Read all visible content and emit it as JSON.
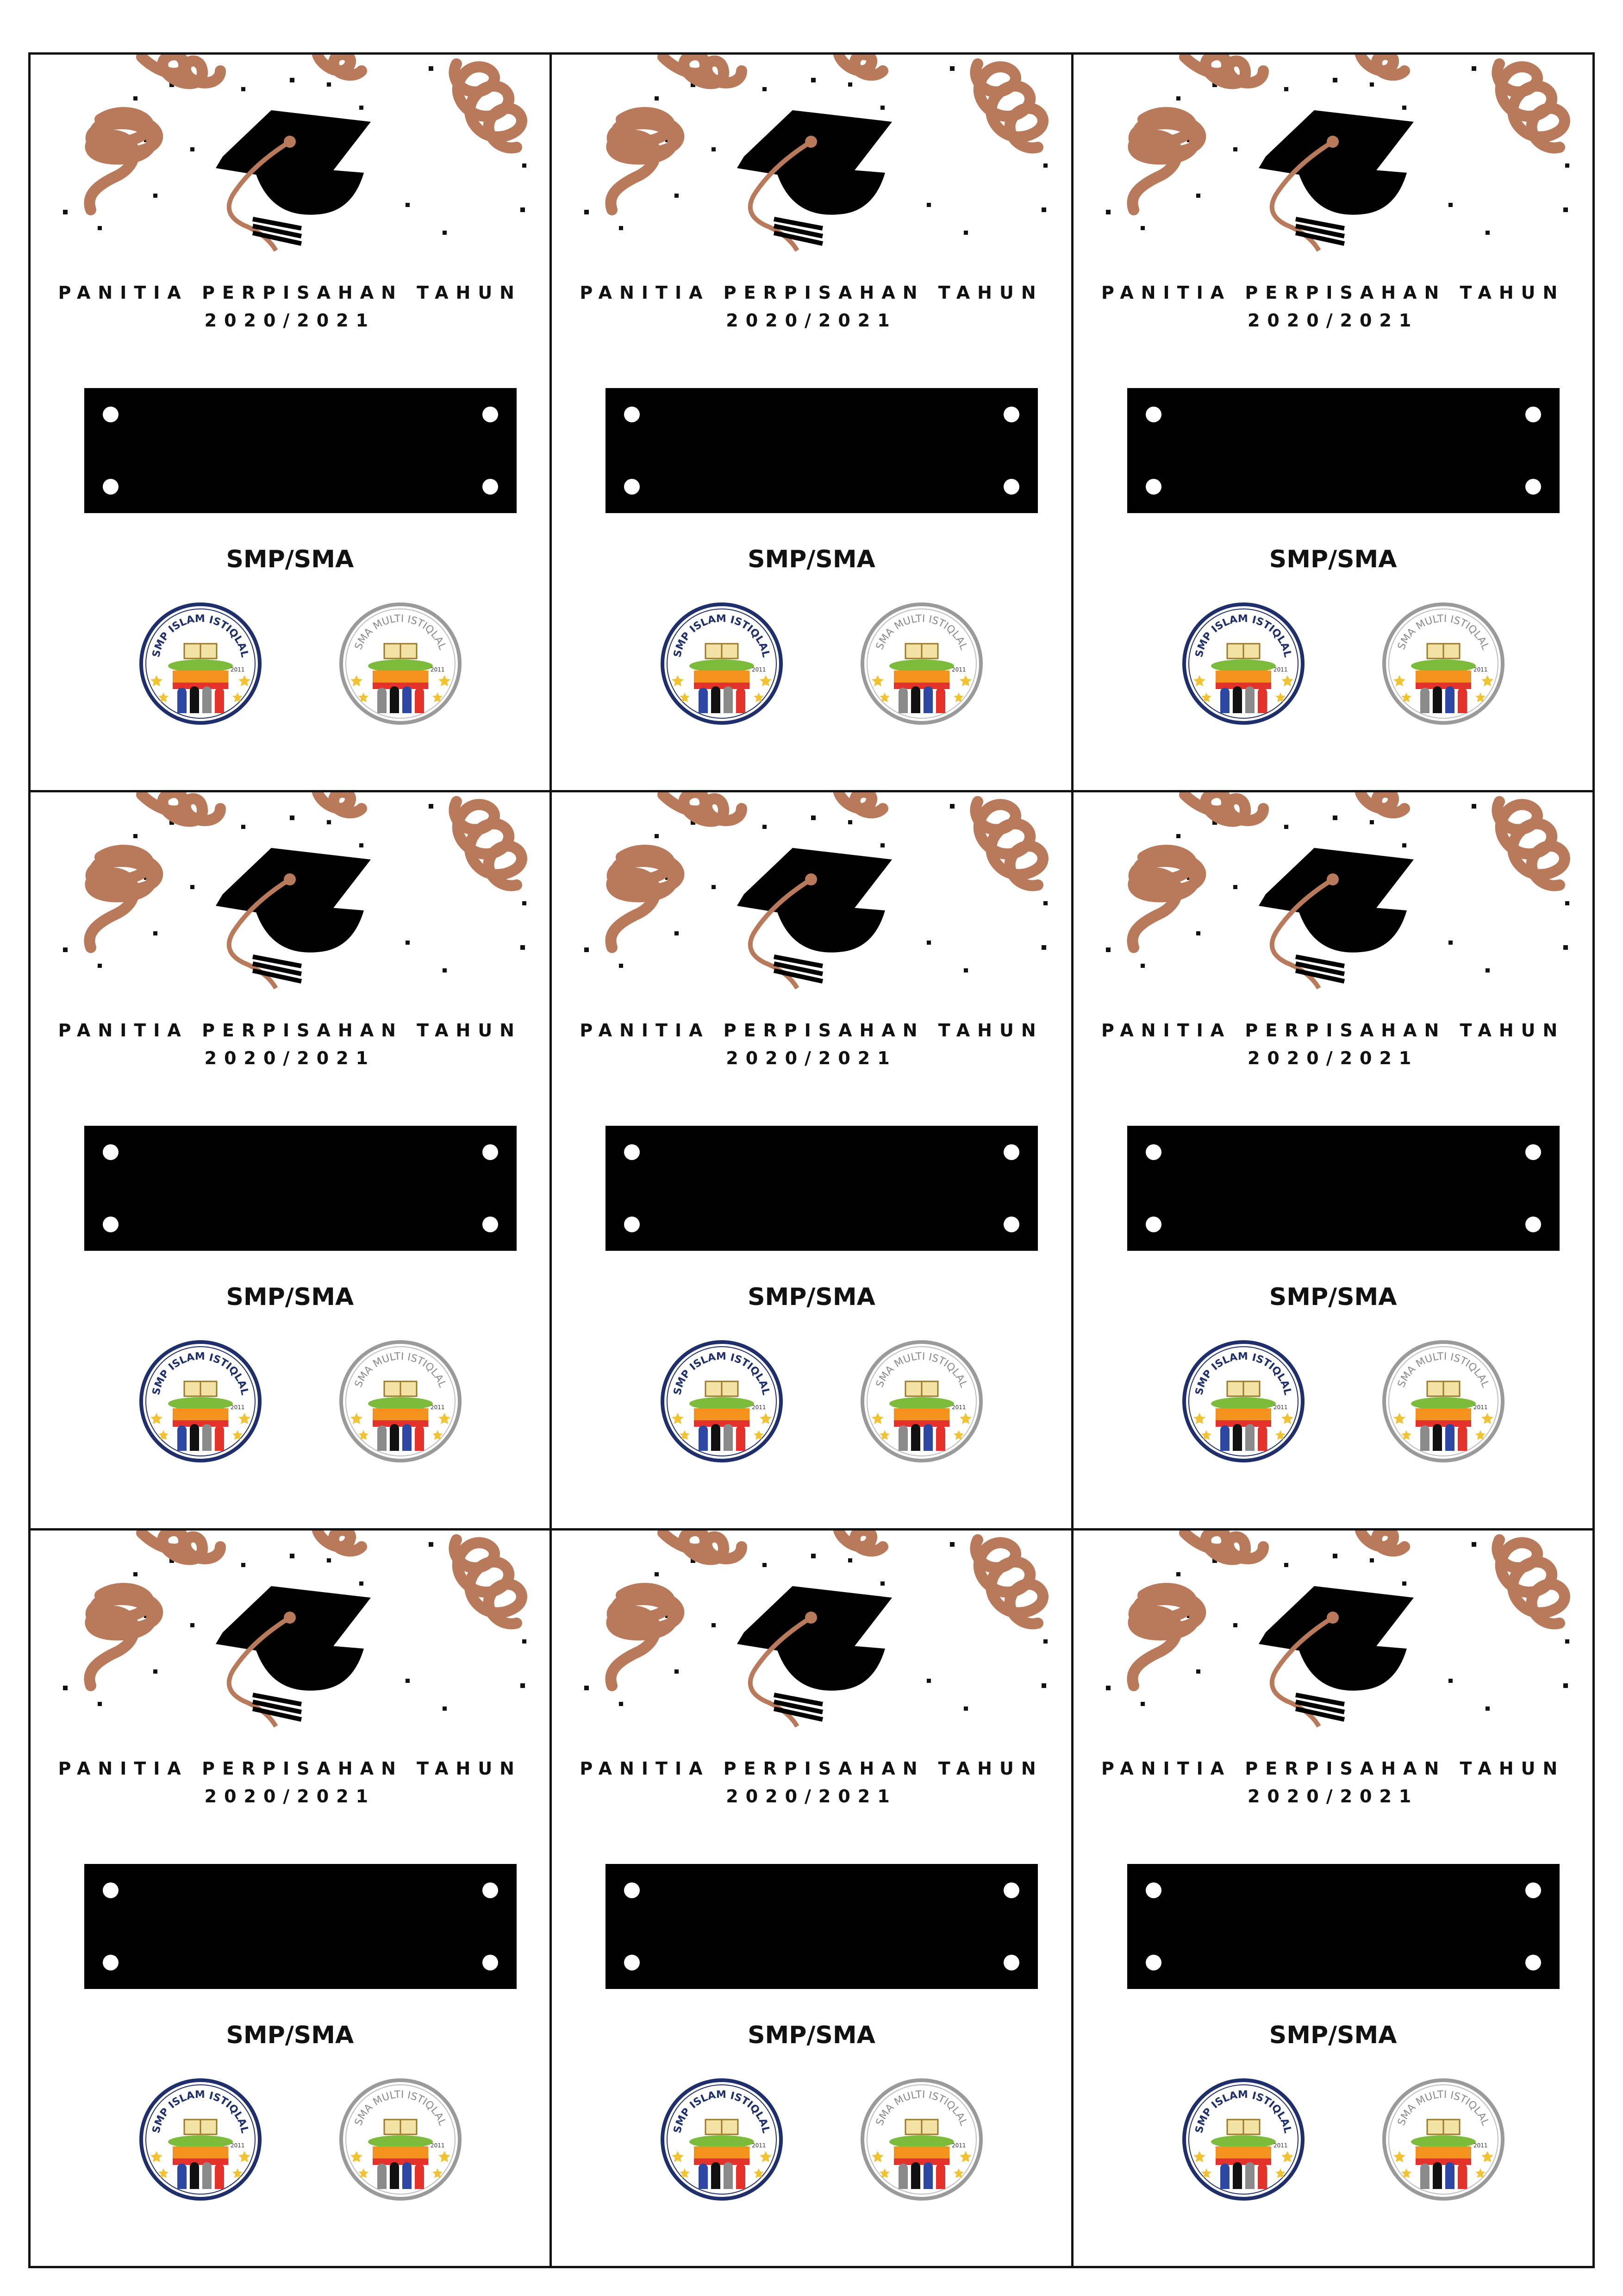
{
  "card": {
    "title_line1": "PANITIA PERPISAHAN TAHUN",
    "title_line2": "2020/2021",
    "level": "SMP/SMA",
    "logo_left_text": "SMP ISLAM ISTIQLAL",
    "logo_right_text": "SMA MULTI ISTIQLAL",
    "logo_year": "2011"
  },
  "cards": [
    {
      "index": 1
    },
    {
      "index": 2
    },
    {
      "index": 3
    },
    {
      "index": 4
    },
    {
      "index": 5
    },
    {
      "index": 6
    },
    {
      "index": 7
    },
    {
      "index": 8
    },
    {
      "index": 9
    }
  ],
  "colors": {
    "streamer": "#b87a5a",
    "cap": "#000000",
    "plate": "#000000",
    "logo_ring_left": "#1f2f6b",
    "logo_ring_right": "#9a9a9a"
  },
  "icons": [
    "graduation-cap-icon",
    "streamer-icon",
    "confetti-icon",
    "school-logo-icon"
  ]
}
